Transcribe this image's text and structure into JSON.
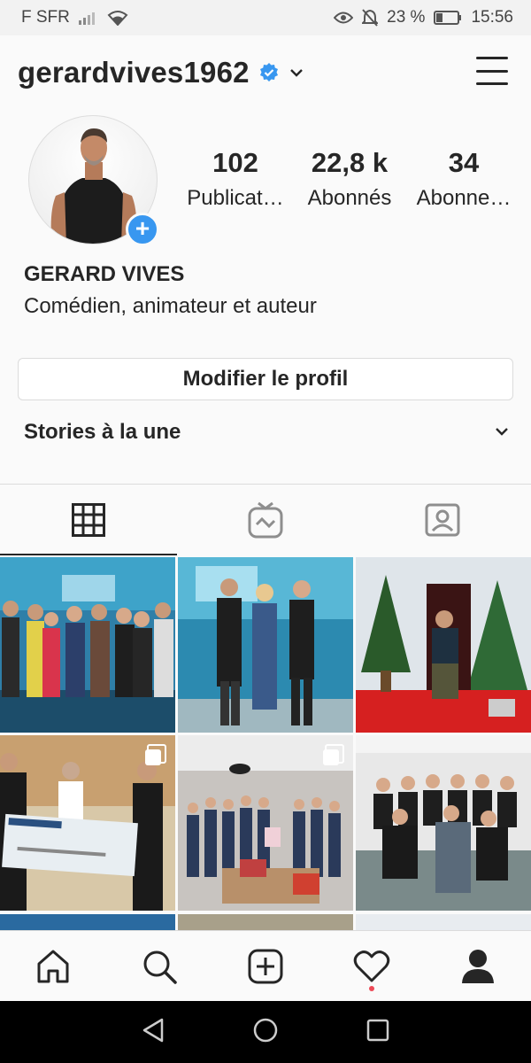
{
  "status_bar": {
    "carrier": "F SFR",
    "battery": "23 %",
    "time": "15:56"
  },
  "header": {
    "username": "gerardvives1962"
  },
  "profile": {
    "stats": [
      {
        "value": "102",
        "label": "Publicat…"
      },
      {
        "value": "22,8 k",
        "label": "Abonnés"
      },
      {
        "value": "34",
        "label": "Abonne…"
      }
    ],
    "full_name": "GERARD VIVES",
    "bio": "Comédien, animateur et auteur",
    "edit_button": "Modifier le profil",
    "stories_label": "Stories à la une"
  },
  "tabs": [
    "grid",
    "igtv",
    "tagged"
  ],
  "colors": {
    "accent": "#3897f0",
    "notification": "#ed4956"
  },
  "posts": [
    {
      "name": "studio-group-photo",
      "multi": false
    },
    {
      "name": "studio-trio-photo",
      "multi": false
    },
    {
      "name": "christmas-throne-photo",
      "multi": false
    },
    {
      "name": "cheque-presentation-photo",
      "multi": true
    },
    {
      "name": "school-group-photo",
      "multi": true
    },
    {
      "name": "office-group-photo",
      "multi": false
    }
  ]
}
